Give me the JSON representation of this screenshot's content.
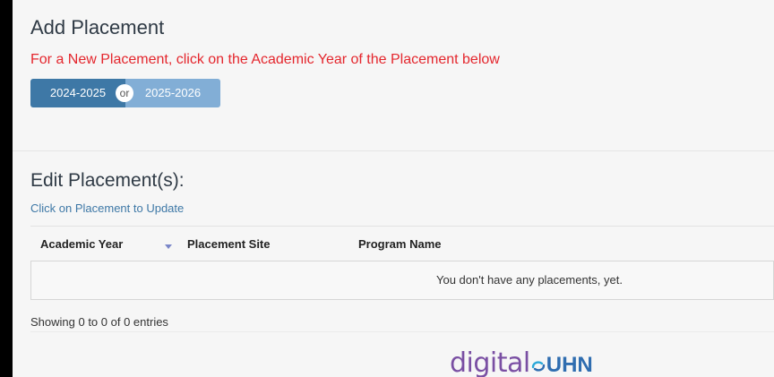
{
  "add_placement": {
    "title": "Add Placement",
    "instruction": "For a New Placement, click on the Academic Year of the Placement below",
    "year_options": [
      "2024-2025",
      "2025-2026"
    ],
    "or_label": "or"
  },
  "edit_placement": {
    "title": "Edit Placement(s):",
    "subtitle": "Click on Placement to Update",
    "table": {
      "columns": [
        "Academic Year",
        "Placement Site",
        "Program Name"
      ],
      "empty_message": "You don't have any placements, yet."
    },
    "showing_text": "Showing 0 to 0 of 0 entries"
  },
  "logo": {
    "part1": "digital",
    "part2": "UHN"
  },
  "colors": {
    "instruction_red": "#e4262d",
    "year_btn_primary": "#3e78a6",
    "year_btn_secondary": "#82aed6",
    "link_blue": "#3e78a6",
    "logo_purple": "#7a4fa3",
    "logo_blue": "#2f6db0"
  },
  "icons": {
    "sort": "sort-desc-icon",
    "logo_mark": "uhn-swirl-icon"
  }
}
